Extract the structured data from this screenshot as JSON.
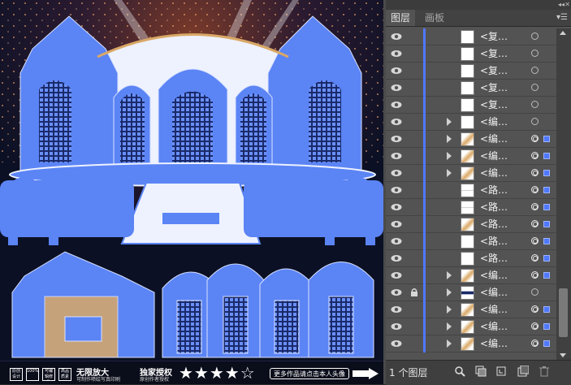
{
  "panel": {
    "tabs": [
      {
        "label": "图层",
        "active": true
      },
      {
        "label": "画板",
        "active": false
      }
    ],
    "menu_icon": "panel-menu-icon",
    "collapse_icon": "double-chevron-icon",
    "close_icon": "close-icon",
    "accent_color": "#4f78ff",
    "rows": [
      {
        "label": "<复…",
        "expandable": false,
        "thumb": "blank",
        "locked": false,
        "selected": false
      },
      {
        "label": "<复…",
        "expandable": false,
        "thumb": "blank",
        "locked": false,
        "selected": false
      },
      {
        "label": "<复…",
        "expandable": false,
        "thumb": "blank",
        "locked": false,
        "selected": false
      },
      {
        "label": "<复…",
        "expandable": false,
        "thumb": "blank",
        "locked": false,
        "selected": false
      },
      {
        "label": "<复…",
        "expandable": false,
        "thumb": "blank",
        "locked": false,
        "selected": false
      },
      {
        "label": "<编…",
        "expandable": true,
        "thumb": "blank",
        "locked": false,
        "selected": false
      },
      {
        "label": "<编…",
        "expandable": true,
        "thumb": "gold",
        "locked": false,
        "selected": true
      },
      {
        "label": "<编…",
        "expandable": true,
        "thumb": "gold",
        "locked": false,
        "selected": true
      },
      {
        "label": "<编…",
        "expandable": true,
        "thumb": "gold",
        "locked": false,
        "selected": true
      },
      {
        "label": "<路…",
        "expandable": false,
        "thumb": "line",
        "locked": false,
        "selected": true
      },
      {
        "label": "<路…",
        "expandable": false,
        "thumb": "line",
        "locked": false,
        "selected": true
      },
      {
        "label": "<路…",
        "expandable": false,
        "thumb": "gold",
        "locked": false,
        "selected": true
      },
      {
        "label": "<路…",
        "expandable": false,
        "thumb": "blank",
        "locked": false,
        "selected": true
      },
      {
        "label": "<路…",
        "expandable": false,
        "thumb": "blank",
        "locked": false,
        "selected": true
      },
      {
        "label": "<编…",
        "expandable": true,
        "thumb": "gold",
        "locked": false,
        "selected": true
      },
      {
        "label": "<编…",
        "expandable": true,
        "thumb": "dark",
        "locked": true,
        "selected": false
      },
      {
        "label": "<编…",
        "expandable": true,
        "thumb": "gold",
        "locked": false,
        "selected": true
      },
      {
        "label": "<编…",
        "expandable": true,
        "thumb": "gold",
        "locked": false,
        "selected": true
      },
      {
        "label": "<编…",
        "expandable": true,
        "thumb": "gold",
        "locked": false,
        "selected": true
      }
    ],
    "footer": {
      "layer_count": "1 个图层",
      "icons": [
        "locate-object-icon",
        "make-clipping-mask-icon",
        "new-sublayer-icon",
        "new-layer-icon",
        "delete-icon"
      ]
    }
  },
  "canvas": {
    "background": "#0b1024",
    "art_color": "#5b84f5",
    "promo": {
      "badges": [
        "原创设计",
        "100%AI/CDR",
        "可编辑修改",
        "高品质素材"
      ],
      "main": "无限放大",
      "sub": "可制作喷绘写真印刷",
      "exclusive": "独家授权",
      "exclusive_sub": "原创作者授权",
      "stars": "★★★★☆",
      "more_button": "更多作品请点击本人头像"
    }
  }
}
